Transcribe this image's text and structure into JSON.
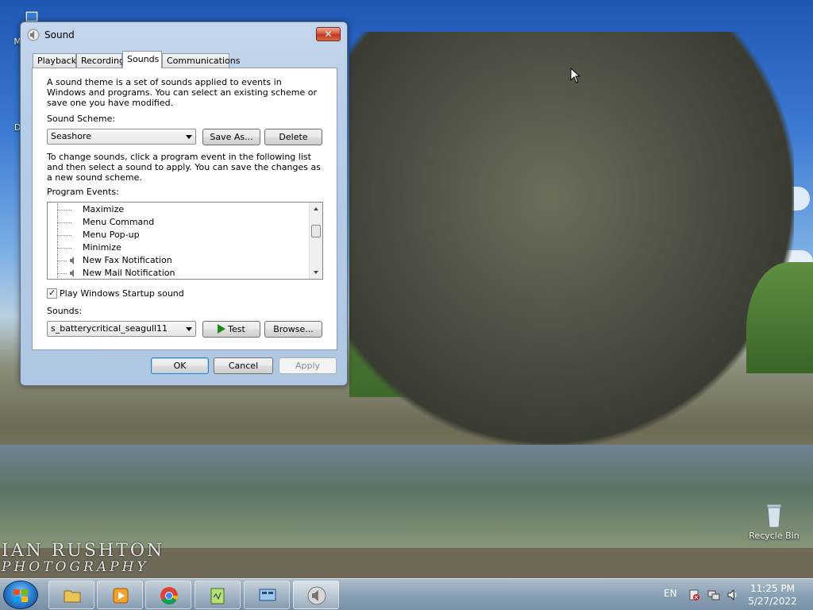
{
  "desktop": {
    "icons": [
      {
        "label": "My C",
        "icon": "computer-icon"
      },
      {
        "label": "Data",
        "icon": "shortcut-icon"
      },
      {
        "label": "Recycle Bin",
        "icon": "recycle-bin-icon"
      }
    ],
    "watermark": {
      "line1": "IAN RUSHTON",
      "line2": "PHOTOGRAPHY"
    }
  },
  "window": {
    "title": "Sound",
    "tabs": [
      "Playback",
      "Recording",
      "Sounds",
      "Communications"
    ],
    "active_tab": "Sounds",
    "description": "A sound theme is a set of sounds applied to events in Windows and programs.  You can select an existing scheme or save one you have modified.",
    "scheme_label": "Sound Scheme:",
    "scheme_value": "Seashore",
    "save_as_label": "Save As...",
    "delete_label": "Delete",
    "change_text": "To change sounds, click a program event in the following list and then select a sound to apply.  You can save the changes as a new sound scheme.",
    "events_label": "Program Events:",
    "events": [
      {
        "label": "Maximize",
        "has_sound": false
      },
      {
        "label": "Menu Command",
        "has_sound": false
      },
      {
        "label": "Menu Pop-up",
        "has_sound": false
      },
      {
        "label": "Minimize",
        "has_sound": false
      },
      {
        "label": "New Fax Notification",
        "has_sound": true
      },
      {
        "label": "New Mail Notification",
        "has_sound": true
      }
    ],
    "startup_label": "Play Windows Startup sound",
    "startup_checked": true,
    "sounds_label": "Sounds:",
    "sound_value": "s_batterycritical_seagull11",
    "test_label": "Test",
    "browse_label": "Browse...",
    "ok_label": "OK",
    "cancel_label": "Cancel",
    "apply_label": "Apply"
  },
  "taskbar": {
    "apps": [
      "explorer-icon",
      "media-player-icon",
      "chrome-icon",
      "notepad-icon",
      "control-panel-icon",
      "sound-icon"
    ],
    "language": "EN",
    "time": "11:25 PM",
    "date": "5/27/2022"
  }
}
